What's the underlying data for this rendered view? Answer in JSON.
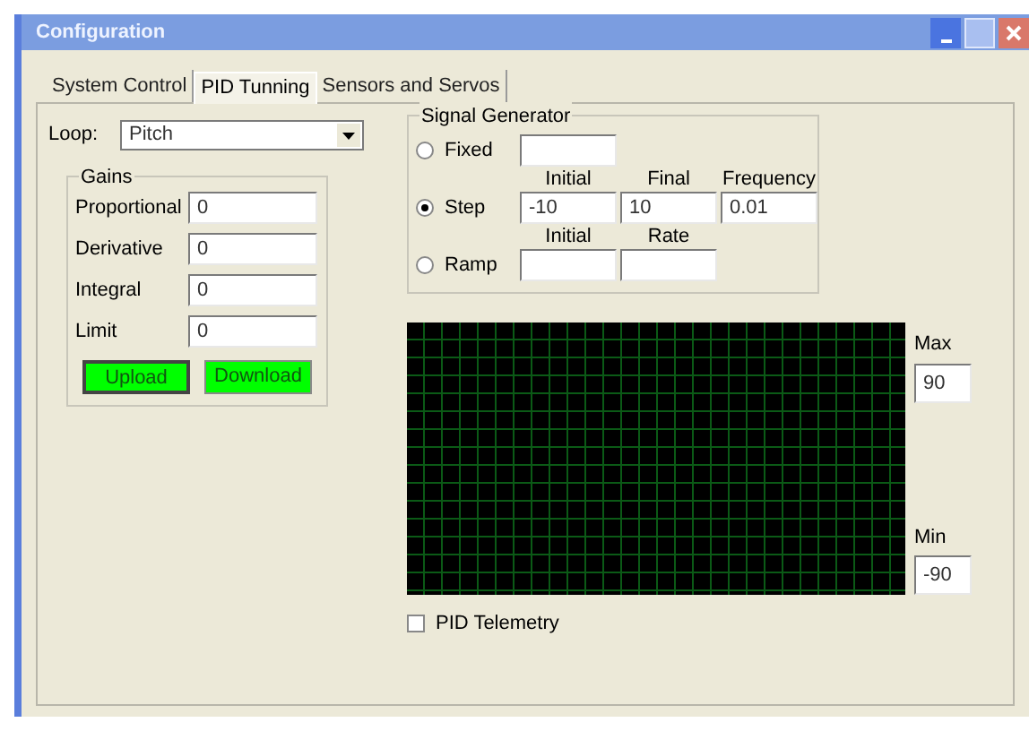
{
  "window": {
    "title": "Configuration"
  },
  "tabs": [
    {
      "label": "System Control",
      "selected": false
    },
    {
      "label": "PID Tunning",
      "selected": true
    },
    {
      "label": "Sensors and Servos",
      "selected": false
    }
  ],
  "loop": {
    "label": "Loop:",
    "value": "Pitch"
  },
  "gains": {
    "title": "Gains",
    "fields": [
      {
        "label": "Proportional",
        "value": "0"
      },
      {
        "label": "Derivative",
        "value": "0"
      },
      {
        "label": "Integral",
        "value": "0"
      },
      {
        "label": "Limit",
        "value": "0"
      }
    ],
    "buttons": [
      "Upload",
      "Download"
    ]
  },
  "signal_generator": {
    "title": "Signal Generator",
    "modes": [
      {
        "label": "Fixed",
        "selected": false,
        "fields": [
          {
            "kind": "blank"
          }
        ]
      },
      {
        "label": "Step",
        "selected": true,
        "fields": [
          {
            "label": "Initial",
            "kind": "text",
            "value": "-10"
          },
          {
            "label": "Final",
            "kind": "text",
            "value": "10"
          },
          {
            "label": "Frequency",
            "kind": "text",
            "value": "0.01"
          }
        ]
      },
      {
        "label": "Ramp",
        "selected": false,
        "fields": [
          {
            "label": "Initial",
            "kind": "blank"
          },
          {
            "label": "Rate",
            "kind": "blank"
          }
        ]
      }
    ]
  },
  "scope": {
    "max_label": "Max",
    "max_value": "90",
    "min_label": "Min",
    "min_value": "-90"
  },
  "telemetry": {
    "label": "PID Telemetry",
    "checked": false
  }
}
